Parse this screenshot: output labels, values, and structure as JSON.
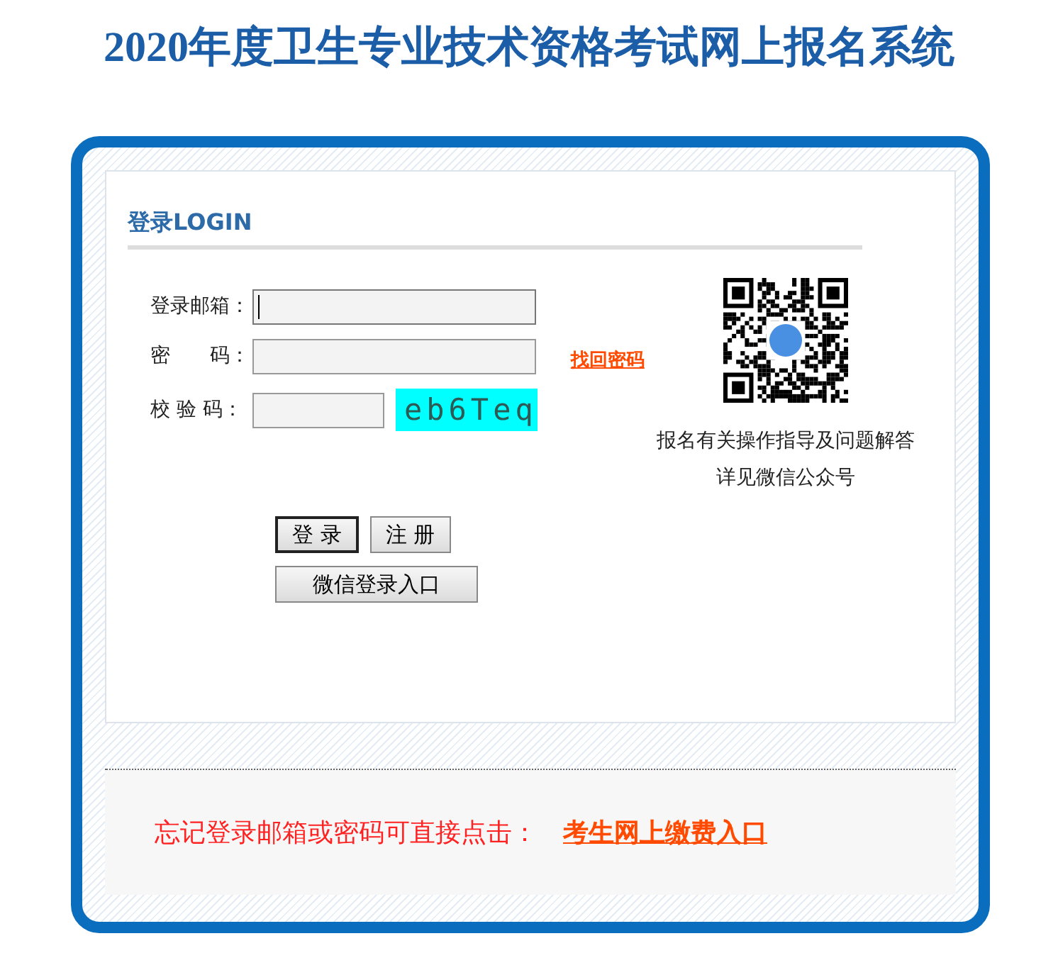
{
  "page_title": "2020年度卫生专业技术资格考试网上报名系统",
  "login_panel": {
    "heading": "登录LOGIN",
    "fields": [
      {
        "label": "登录邮箱：",
        "kind": "text",
        "focused": true
      },
      {
        "label": "密　　码：",
        "kind": "password",
        "focused": false
      },
      {
        "label": "校 验 码：",
        "kind": "captcha",
        "focused": false,
        "captcha": "eb6Teq"
      }
    ],
    "forgot_link": "找回密码",
    "qr_caption": [
      "报名有关操作指导及问题解答",
      "详见微信公众号"
    ],
    "buttons": [
      {
        "label": "登 录",
        "kind": "default"
      },
      {
        "label": "注 册",
        "kind": "normal"
      }
    ],
    "wechat_button": "微信登录入口"
  },
  "footer": {
    "text": "忘记登录邮箱或密码可直接点击：",
    "link": "考生网上缴费入口"
  }
}
